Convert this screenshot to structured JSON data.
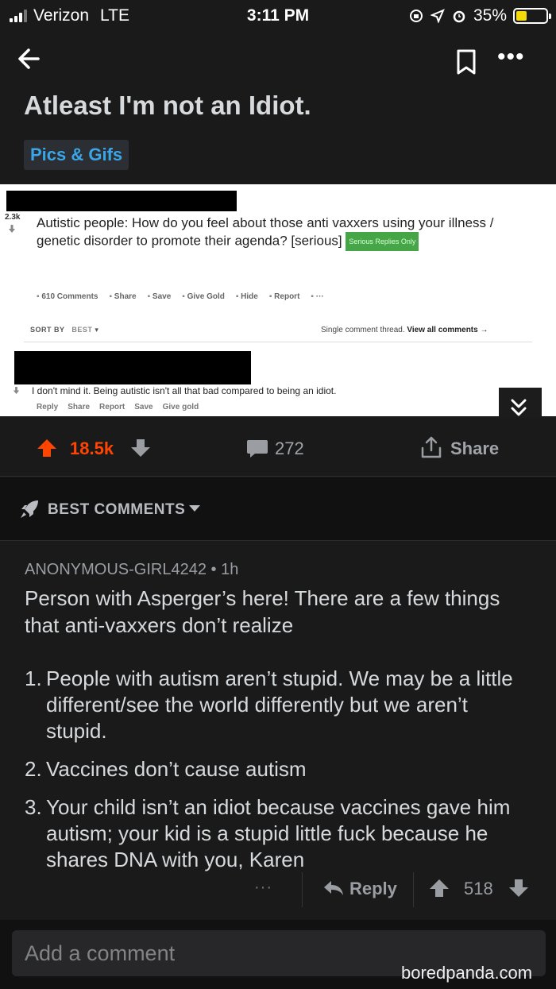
{
  "status_bar": {
    "carrier": "Verizon",
    "network": "LTE",
    "time": "3:11 PM",
    "battery_percent": "35%",
    "battery_level": 0.35
  },
  "post": {
    "title": "Atleast I'm not an Idiot.",
    "flair": "Pics & Gifs"
  },
  "embedded_screenshot": {
    "score": "2.3k",
    "question": "Autistic people: How do you feel about those anti vaxxers using your illness / genetic disorder to promote their agenda? [serious]",
    "serious_tag": "Serious Replies Only",
    "actions": [
      "610 Comments",
      "Share",
      "Save",
      "Give Gold",
      "Hide",
      "Report",
      "···"
    ],
    "sort_label": "SORT BY",
    "sort_value": "BEST",
    "thread_note": "Single comment thread.",
    "thread_link": "View all comments →",
    "comment_text": "I don't mind it. Being autistic isn't all that bad compared to being an idiot.",
    "comment_actions": [
      "Reply",
      "Share",
      "Report",
      "Save",
      "Give gold"
    ]
  },
  "vote_bar": {
    "score": "18.5k",
    "comments": "272",
    "share_label": "Share"
  },
  "sort": {
    "label": "BEST COMMENTS"
  },
  "comment": {
    "author": "ANONYMOUS-GIRL4242 • 1h",
    "intro": "Person with Asperger’s here! There are a few things that anti-vaxxers don’t realize",
    "items": [
      {
        "num": "1.",
        "text": "People with autism aren’t stupid. We may be a little different/see the world differently but we aren’t stupid."
      },
      {
        "num": "2.",
        "text": "Vaccines don’t cause autism"
      },
      {
        "num": "3.",
        "text": "Your child isn’t an idiot because vaccines gave him autism; your kid is a stupid little fuck because he shares DNA with you, Karen"
      }
    ],
    "more": "···",
    "reply_label": "Reply",
    "score": "518"
  },
  "add_comment": {
    "placeholder": "Add a comment"
  },
  "watermark": "boredpanda.com",
  "colors": {
    "upvote": "#ff4500",
    "flair_text": "#3aa6e8",
    "background": "#1a1a1b"
  }
}
